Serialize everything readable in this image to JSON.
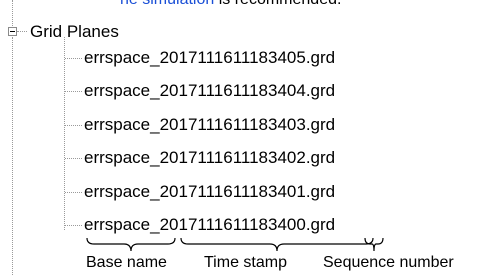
{
  "header_fragment": {
    "link_text": "ne simulation",
    "rest_text": " is recommended."
  },
  "tree": {
    "root_label": "Grid Planes",
    "items": [
      {
        "label": "errspace_2017111611183405.grd"
      },
      {
        "label": "errspace_2017111611183404.grd"
      },
      {
        "label": "errspace_2017111611183403.grd"
      },
      {
        "label": "errspace_2017111611183402.grd"
      },
      {
        "label": "errspace_2017111611183401.grd"
      },
      {
        "label": "errspace_2017111611183400.grd"
      }
    ]
  },
  "annotations": {
    "base_name": "Base name",
    "time_stamp": "Time stamp",
    "sequence_number": "Sequence number"
  }
}
